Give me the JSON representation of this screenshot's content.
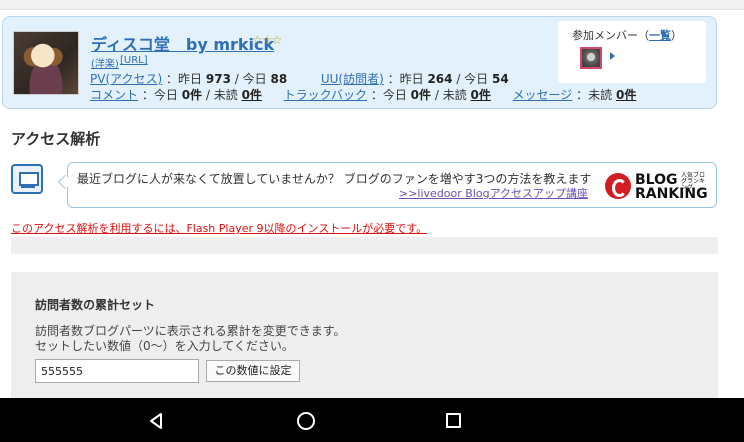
{
  "profile": {
    "blog_title": "ディスコ堂　by mrkick",
    "stars": "☆☆☆",
    "tag1": "(洋楽)",
    "tag2": "[URL]",
    "pv_label": "PV(アクセス)",
    "pv_yesterday_label": "：昨日",
    "pv_yesterday": "973",
    "pv_today_label": "/ 今日",
    "pv_today": "88",
    "uu_label": "UU(訪問者)",
    "uu_yesterday_label": "：昨日",
    "uu_yesterday": "264",
    "uu_today_label": "/ 今日",
    "uu_today": "54",
    "comment_label": "コメント",
    "comment_today_label": "：今日",
    "comment_today": "0件",
    "comment_unread_label": "/ 未読",
    "comment_unread": "0件",
    "trackback_label": "トラックバック",
    "trackback_today_label": "：今日",
    "trackback_today": "0件",
    "trackback_unread_label": "/ 未読",
    "trackback_unread": "0件",
    "message_label": "メッセージ",
    "message_unread_label": "：未読",
    "message_unread": "0件",
    "member_label": "参加メンバー（",
    "member_list_link": "一覧",
    "member_label_end": "）"
  },
  "section_title": "アクセス解析",
  "promo": {
    "text": "最近ブログに人が来なくて放置していませんか？ ブログのファンを増やす3つの方法を教えます",
    "link": ">>livedoor Blogアクセスアップ講座",
    "brand_line1": "BLOG",
    "brand_small": "人気ブログランキング",
    "brand_line2": "RANKING"
  },
  "flash_warning": "このアクセス解析を利用するには、Flash Player 9以降のインストールが必要です。",
  "counter": {
    "title": "訪問者数の累計セット",
    "desc1": "訪問者数ブログパーツに表示される累計を変更できます。",
    "desc2": "セットしたい数値（0〜）を入力してください。",
    "input_value": "555555",
    "button_label": "この数値に設定"
  }
}
